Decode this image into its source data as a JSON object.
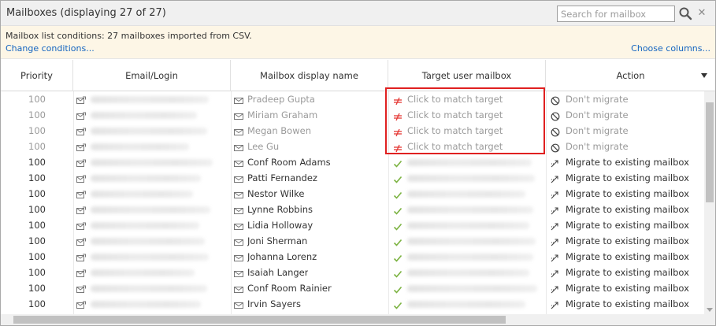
{
  "window": {
    "title": "Mailboxes (displaying 27 of 27)",
    "search_placeholder": "Search for mailbox"
  },
  "conditions": {
    "text": "Mailbox list conditions: 27 mailboxes imported from CSV.",
    "change_link": "Change conditions...",
    "choose_columns_link": "Choose columns..."
  },
  "columns": {
    "priority": "Priority",
    "email": "Email/Login",
    "display_name": "Mailbox display name",
    "target": "Target user mailbox",
    "action": "Action"
  },
  "colors": {
    "highlight": "#e02020",
    "link": "#1565c0",
    "check": "#7cb342",
    "mismatch": "#e53935"
  },
  "rows": [
    {
      "priority": "100",
      "name": "Pradeep Gupta",
      "target": "Click to match target",
      "action": "Don't migrate",
      "matched": false
    },
    {
      "priority": "100",
      "name": "Miriam Graham",
      "target": "Click to match target",
      "action": "Don't migrate",
      "matched": false
    },
    {
      "priority": "100",
      "name": "Megan Bowen",
      "target": "Click to match target",
      "action": "Don't migrate",
      "matched": false
    },
    {
      "priority": "100",
      "name": "Lee Gu",
      "target": "Click to match target",
      "action": "Don't migrate",
      "matched": false
    },
    {
      "priority": "100",
      "name": "Conf Room Adams",
      "target": "",
      "action": "Migrate to existing mailbox",
      "matched": true
    },
    {
      "priority": "100",
      "name": "Patti Fernandez",
      "target": "",
      "action": "Migrate to existing mailbox",
      "matched": true
    },
    {
      "priority": "100",
      "name": "Nestor Wilke",
      "target": "",
      "action": "Migrate to existing mailbox",
      "matched": true
    },
    {
      "priority": "100",
      "name": "Lynne Robbins",
      "target": "",
      "action": "Migrate to existing mailbox",
      "matched": true
    },
    {
      "priority": "100",
      "name": "Lidia Holloway",
      "target": "",
      "action": "Migrate to existing mailbox",
      "matched": true
    },
    {
      "priority": "100",
      "name": "Joni Sherman",
      "target": "",
      "action": "Migrate to existing mailbox",
      "matched": true
    },
    {
      "priority": "100",
      "name": "Johanna Lorenz",
      "target": "",
      "action": "Migrate to existing mailbox",
      "matched": true
    },
    {
      "priority": "100",
      "name": "Isaiah Langer",
      "target": "",
      "action": "Migrate to existing mailbox",
      "matched": true
    },
    {
      "priority": "100",
      "name": "Conf Room Rainier",
      "target": "",
      "action": "Migrate to existing mailbox",
      "matched": true
    },
    {
      "priority": "100",
      "name": "Irvin Sayers",
      "target": "",
      "action": "Migrate to existing mailbox",
      "matched": true
    }
  ]
}
